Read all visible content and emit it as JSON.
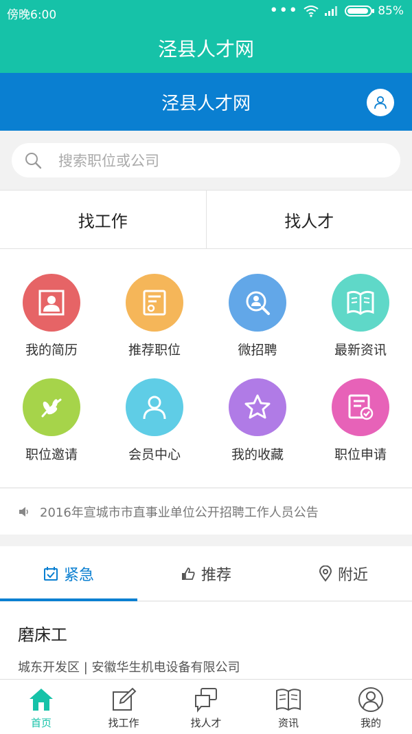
{
  "status_bar": {
    "time": "傍晚6:00",
    "dots": "•••",
    "battery": "85%"
  },
  "app_title": "泾县人才网",
  "header": {
    "title": "泾县人才网"
  },
  "search": {
    "placeholder": "搜索职位或公司"
  },
  "main_tabs": [
    {
      "label": "找工作"
    },
    {
      "label": "找人才"
    }
  ],
  "features": [
    {
      "label": "我的简历",
      "icon": "resume-icon",
      "color": "#e66466"
    },
    {
      "label": "推荐职位",
      "icon": "certificate-icon",
      "color": "#f5b659"
    },
    {
      "label": "微招聘",
      "icon": "magnify-person-icon",
      "color": "#62a7e8"
    },
    {
      "label": "最新资讯",
      "icon": "book-icon",
      "color": "#5fd8c8"
    },
    {
      "label": "职位邀请",
      "icon": "leaf-icon",
      "color": "#a6d44a"
    },
    {
      "label": "会员中心",
      "icon": "user-icon",
      "color": "#5fcde6"
    },
    {
      "label": "我的收藏",
      "icon": "star-icon",
      "color": "#b07be6"
    },
    {
      "label": "职位申请",
      "icon": "form-check-icon",
      "color": "#e762b8"
    }
  ],
  "notice": {
    "text": "2016年宣城市市直事业单位公开招聘工作人员公告"
  },
  "sub_tabs": [
    {
      "label": "紧急",
      "icon": "urgent-icon",
      "active": true
    },
    {
      "label": "推荐",
      "icon": "thumbs-up-icon",
      "active": false
    },
    {
      "label": "附近",
      "icon": "location-pin-icon",
      "active": false
    }
  ],
  "job": {
    "title": "磨床工",
    "meta": "城东开发区 | 安徽华生机电设备有限公司"
  },
  "bottom_nav": [
    {
      "label": "首页",
      "active": true
    },
    {
      "label": "找工作",
      "active": false
    },
    {
      "label": "找人才",
      "active": false
    },
    {
      "label": "资讯",
      "active": false
    },
    {
      "label": "我的",
      "active": false
    }
  ],
  "colors": {
    "teal": "#16c2a8",
    "blue": "#0a7fd1"
  }
}
